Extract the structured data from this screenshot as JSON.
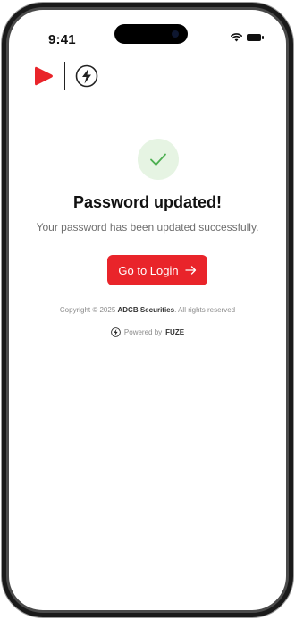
{
  "status_bar": {
    "time": "9:41"
  },
  "main": {
    "title": "Password updated!",
    "subtitle": "Your password has been updated successfully.",
    "button_label": "Go to Login"
  },
  "footer": {
    "copyright_prefix": "Copyright © 2025",
    "company": "ADCB Securities",
    "copyright_suffix": ". All rights reserved",
    "powered_prefix": "Powered by",
    "powered_brand": "FUZE"
  },
  "colors": {
    "accent_red": "#e9242a",
    "success_green": "#4caf50",
    "success_bg": "#e6f4e3"
  },
  "icons": [
    "play-logo-icon",
    "lightning-bolt-icon",
    "checkmark-icon",
    "arrow-right-icon",
    "wifi-icon",
    "battery-icon"
  ]
}
